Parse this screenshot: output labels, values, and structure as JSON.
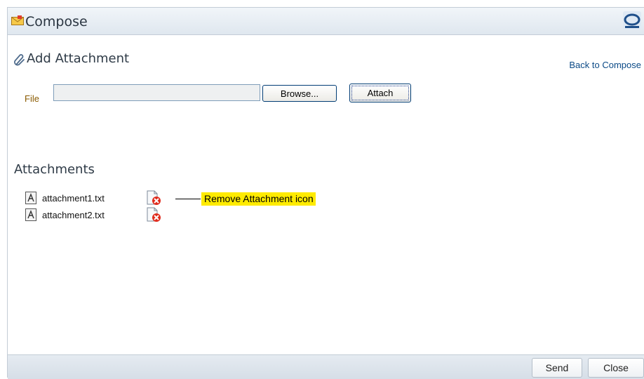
{
  "window": {
    "title": "Compose",
    "title_icon": "envelope-compose-icon",
    "brand_icon": "oracle-logo-icon"
  },
  "subheader": {
    "title": "Add Attachment",
    "icon": "paperclip-icon",
    "back_link": "Back to Compose"
  },
  "file_row": {
    "label": "File",
    "value": "",
    "browse_label": "Browse...",
    "attach_label": "Attach"
  },
  "attachments": {
    "heading": "Attachments",
    "items": [
      {
        "name": "attachment1.txt",
        "file_icon": "text-file-icon",
        "remove_icon": "remove-attachment-icon"
      },
      {
        "name": "attachment2.txt",
        "file_icon": "text-file-icon",
        "remove_icon": "remove-attachment-icon"
      }
    ]
  },
  "callout": {
    "text": "Remove Attachment icon",
    "color": "#ffeb00"
  },
  "footer": {
    "send_label": "Send",
    "close_label": "Close"
  },
  "colors": {
    "link": "#0b4a87",
    "file_label": "#8a5a00",
    "titlebar": "#dfe7ef"
  }
}
